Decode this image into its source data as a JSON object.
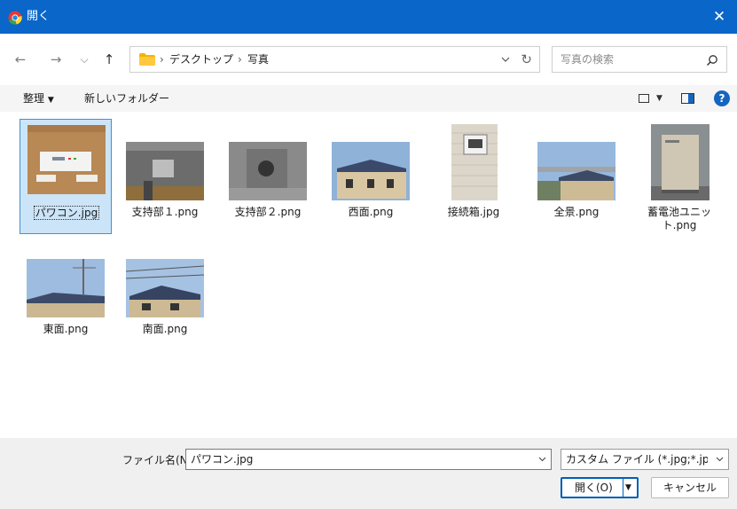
{
  "window": {
    "title": "開く",
    "close_glyph": "✕"
  },
  "nav": {
    "back": "←",
    "forward": "→",
    "recent": "⌵",
    "up": "↑",
    "breadcrumb": [
      "デスクトップ",
      "写真"
    ],
    "sep": "›",
    "refresh": "↻"
  },
  "search": {
    "placeholder": "写真の検索"
  },
  "toolbar": {
    "organize": "整理",
    "new_folder": "新しいフォルダー",
    "help": "?"
  },
  "files": [
    {
      "name": "パワコン.jpg",
      "selected": true
    },
    {
      "name": "支持部１.png",
      "selected": false
    },
    {
      "name": "支持部２.png",
      "selected": false
    },
    {
      "name": "西面.png",
      "selected": false
    },
    {
      "name": "接続箱.jpg",
      "selected": false
    },
    {
      "name": "全景.png",
      "selected": false
    },
    {
      "name": "蓄電池ユニット.png",
      "selected": false
    },
    {
      "name": "東面.png",
      "selected": false
    },
    {
      "name": "南面.png",
      "selected": false
    }
  ],
  "footer": {
    "filename_label": "ファイル名(N):",
    "filename_value": "パワコン.jpg",
    "filetype_value": "カスタム ファイル (*.jpg;*.jpeg;*.pn",
    "open_label": "開く(O)",
    "cancel_label": "キャンセル"
  },
  "colors": {
    "accent": "#0a66c8",
    "selection": "#cce4f7",
    "selection_border": "#3e93d8"
  }
}
